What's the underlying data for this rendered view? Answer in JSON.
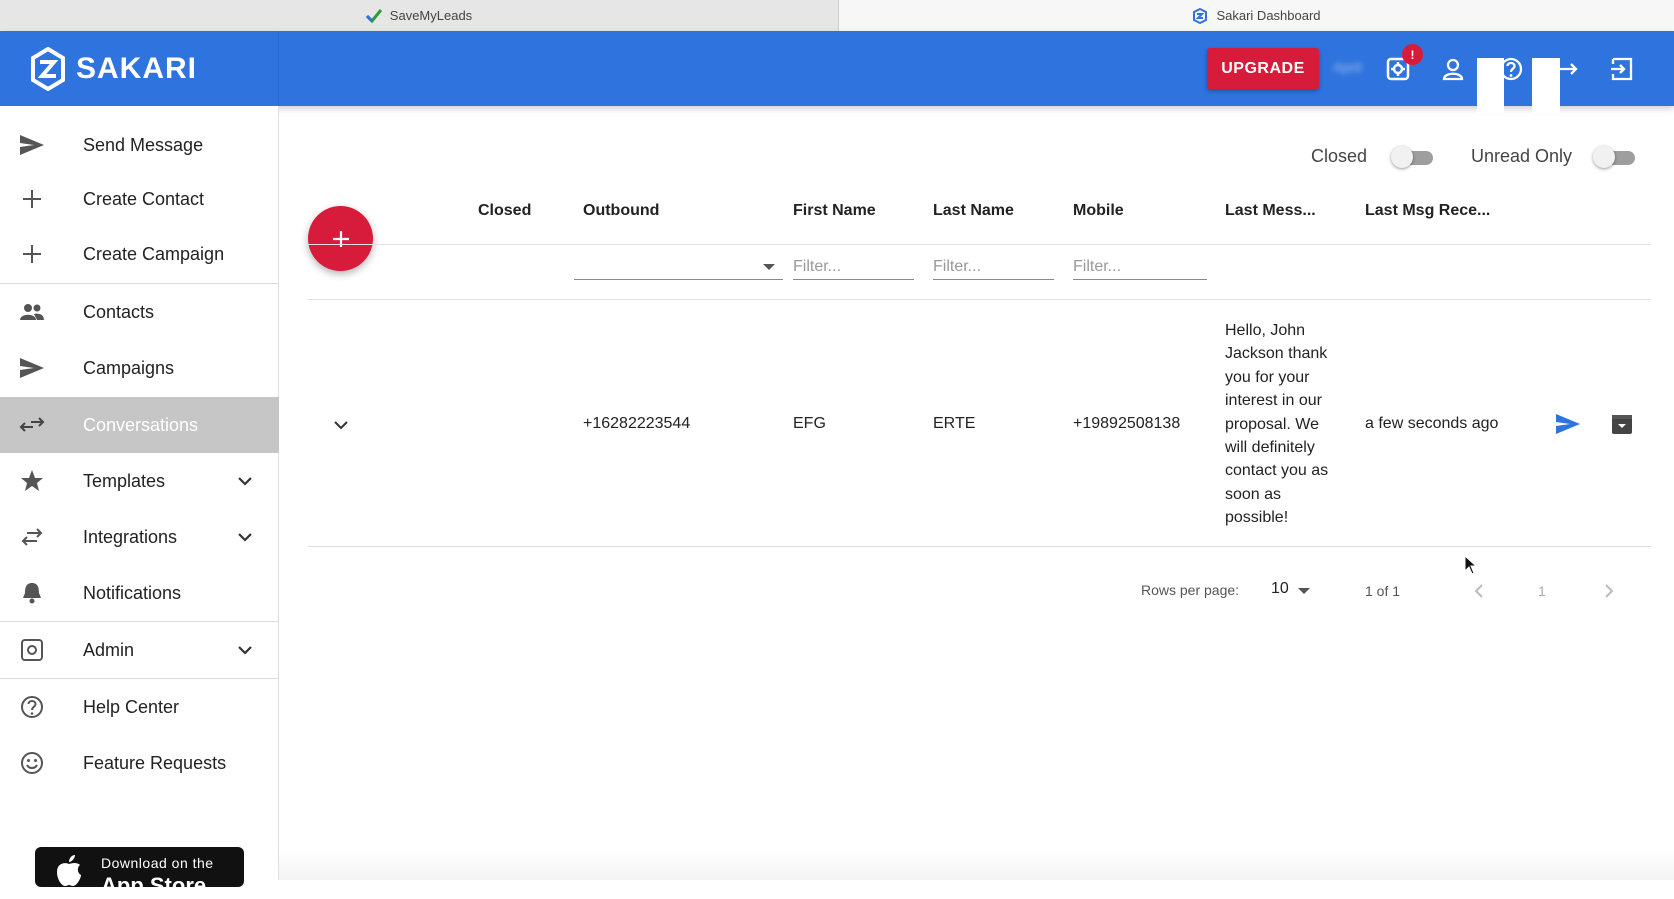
{
  "browser": {
    "tabs": [
      {
        "title": "SaveMyLeads"
      },
      {
        "title": "Sakari Dashboard"
      }
    ]
  },
  "header": {
    "brand": "SAKARI",
    "upgrade_label": "UPGRADE",
    "account_name": "Aprit",
    "notification_badge": "!",
    "brand_color": "#2e73de",
    "accent_color": "#d71b3b"
  },
  "sidebar": {
    "items": [
      {
        "label": "Send Message",
        "icon": "send-icon"
      },
      {
        "label": "Create Contact",
        "icon": "plus-icon"
      },
      {
        "label": "Create Campaign",
        "icon": "plus-icon"
      },
      {
        "label": "Contacts",
        "icon": "people-icon"
      },
      {
        "label": "Campaigns",
        "icon": "send-icon"
      },
      {
        "label": "Conversations",
        "icon": "swap-arrows-icon",
        "active": true
      },
      {
        "label": "Templates",
        "icon": "star-icon",
        "expandable": true
      },
      {
        "label": "Integrations",
        "icon": "exchange-icon",
        "expandable": true
      },
      {
        "label": "Notifications",
        "icon": "bell-icon"
      },
      {
        "label": "Admin",
        "icon": "admin-gear-icon",
        "expandable": true
      },
      {
        "label": "Help Center",
        "icon": "help-circle-icon"
      },
      {
        "label": "Feature Requests",
        "icon": "smiley-icon"
      }
    ],
    "appstore_line1": "Download on the",
    "appstore_line2": "App Store"
  },
  "toggles": {
    "closed_label": "Closed",
    "closed_on": false,
    "unread_label": "Unread Only",
    "unread_on": false
  },
  "table": {
    "columns": [
      "Closed",
      "Outbound",
      "First Name",
      "Last Name",
      "Mobile",
      "Last Mess...",
      "Last Msg Rece..."
    ],
    "filter_placeholder": "Filter...",
    "rows": [
      {
        "outbound": "+16282223544",
        "first_name": "EFG",
        "last_name": "ERTE",
        "mobile": "+19892508138",
        "last_message": "Hello, John Jackson thank you for your interest in our proposal. We will definitely contact you as soon as possible!",
        "last_received": "a few seconds ago"
      }
    ]
  },
  "pagination": {
    "rows_per_page_label": "Rows per page:",
    "rows_per_page": "10",
    "range": "1 of 1",
    "current_page": "1"
  }
}
